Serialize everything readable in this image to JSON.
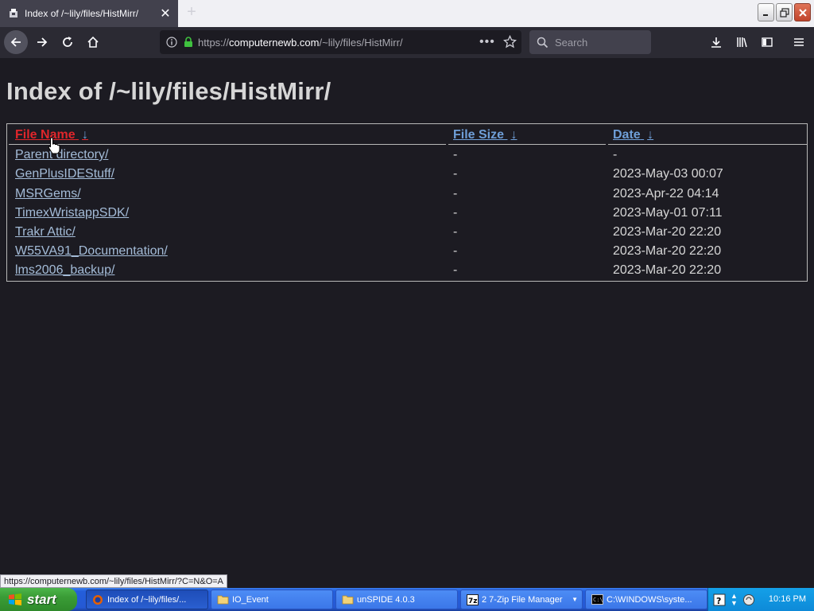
{
  "browser": {
    "tab_title": "Index of /~lily/files/HistMirr/",
    "url_prefix": "https://",
    "url_domain": "computernewb.com",
    "url_path": "/~lily/files/HistMirr/",
    "search_placeholder": "Search"
  },
  "page": {
    "title": "Index of /~lily/files/HistMirr/",
    "headers": {
      "name": "File Name",
      "size": "File Size",
      "date": "Date",
      "sort_arrow": "↓"
    },
    "rows": [
      {
        "name": "Parent directory/",
        "size": "-",
        "date": "-"
      },
      {
        "name": "GenPlusIDEStuff/",
        "size": "-",
        "date": "2023-May-03 00:07"
      },
      {
        "name": "MSRGems/",
        "size": "-",
        "date": "2023-Apr-22 04:14"
      },
      {
        "name": "TimexWristappSDK/",
        "size": "-",
        "date": "2023-May-01 07:11"
      },
      {
        "name": "Trakr Attic/",
        "size": "-",
        "date": "2023-Mar-20 22:20"
      },
      {
        "name": "W55VA91_Documentation/",
        "size": "-",
        "date": "2023-Mar-20 22:20"
      },
      {
        "name": "lms2006_backup/",
        "size": "-",
        "date": "2023-Mar-20 22:20"
      }
    ]
  },
  "status": {
    "hover_url": "https://computernewb.com/~lily/files/HistMirr/?C=N&O=A"
  },
  "taskbar": {
    "start_label": "start",
    "items": [
      {
        "label": "Index of /~lily/files/...",
        "icon": "firefox-icon"
      },
      {
        "label": "IO_Event",
        "icon": "folder-icon"
      },
      {
        "label": "unSPIDE 4.0.3",
        "icon": "folder-icon"
      },
      {
        "label": "2  7-Zip File Manager",
        "icon": "7zip-icon"
      },
      {
        "label": "C:\\WINDOWS\\syste...",
        "icon": "cmd-icon"
      }
    ],
    "clock": "10:16 PM"
  },
  "colors": {
    "header_active": "#e0262b",
    "header_link": "#6f9fd8",
    "link": "#a4bcd8",
    "text": "#d6d6d6"
  }
}
